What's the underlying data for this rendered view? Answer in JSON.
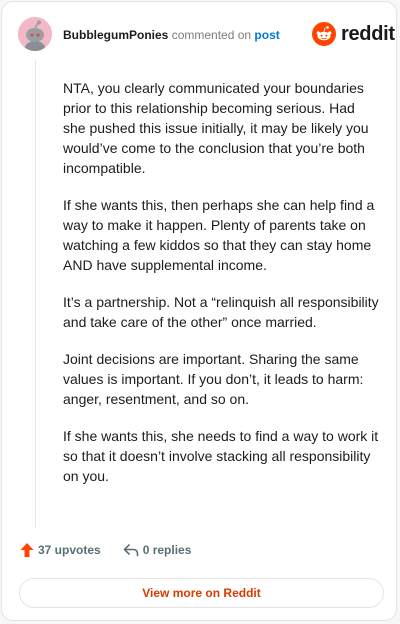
{
  "comment": {
    "username": "BubblegumPonies",
    "action_text": "commented on",
    "link_text": "post",
    "paragraphs": [
      "NTA, you clearly communicated your boundaries prior to this relationship becoming serious. Had she pushed this issue initially, it may be likely you would’ve come to the conclusion that you’re both incompatible.",
      "If she wants this, then perhaps she can help find a way to make it happen. Plenty of parents take on watching a few kiddos so that they can stay home AND have supplemental income.",
      "It’s a partnership. Not a “relinquish all responsibility and take care of the other” once married.",
      "Joint decisions are important. Sharing the same values is important. If you don’t, it leads to harm: anger, resentment, and so on.",
      "If she wants this, she needs to find a way to work it so that it doesn’t involve stacking all responsibility on you."
    ]
  },
  "brand": {
    "name": "reddit",
    "icon": "reddit-logo-icon",
    "color": "#ff4500"
  },
  "footer": {
    "upvotes_label": "37 upvotes",
    "upvote_icon": "upvote-arrow-icon",
    "replies_label": "0 replies",
    "reply_icon": "reply-arrow-icon"
  },
  "cta": {
    "label": "View more on Reddit"
  },
  "colors": {
    "accent": "#d93a00",
    "upvote": "#ff4500",
    "link": "#0079d3"
  }
}
